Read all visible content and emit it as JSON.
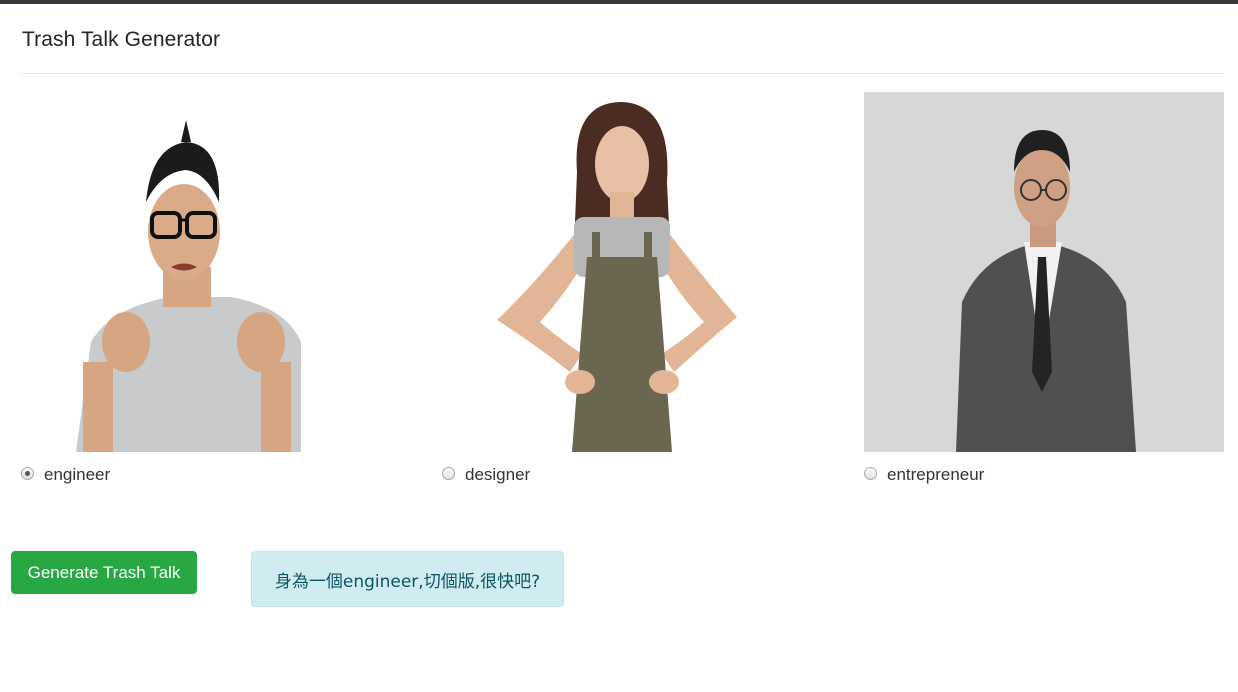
{
  "header": {
    "title": "Trash Talk Generator"
  },
  "colors": {
    "topbar": "#343a40",
    "primary_button": "#28a745",
    "alert_bg": "#d1ecf1",
    "alert_text": "#0c5460"
  },
  "options": [
    {
      "id": "engineer",
      "label": "engineer",
      "checked": true
    },
    {
      "id": "designer",
      "label": "designer",
      "checked": false
    },
    {
      "id": "entrepreneur",
      "label": "entrepreneur",
      "checked": false
    }
  ],
  "actions": {
    "generate_label": "Generate Trash Talk"
  },
  "result": {
    "text": "身為一個engineer,切個版,很快吧?"
  }
}
